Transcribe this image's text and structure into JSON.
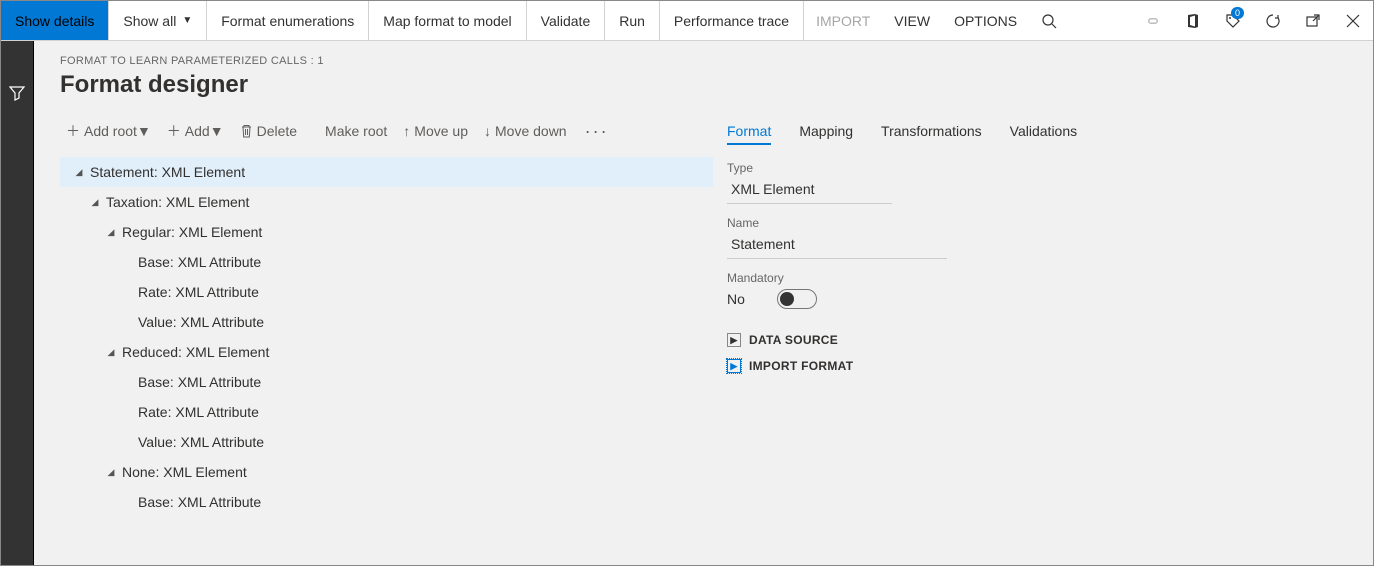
{
  "topbar": {
    "show_details": "Show details",
    "show_all": "Show all",
    "format_enum": "Format enumerations",
    "map_format": "Map format to model",
    "validate": "Validate",
    "run": "Run",
    "perf_trace": "Performance trace",
    "import": "IMPORT",
    "view": "VIEW",
    "options": "OPTIONS",
    "badge": "0"
  },
  "crumb": "FORMAT TO LEARN PARAMETERIZED CALLS : 1",
  "title": "Format designer",
  "toolbar": {
    "add_root": "Add root",
    "add": "Add",
    "delete": "Delete",
    "make_root": "Make root",
    "move_up": "Move up",
    "move_down": "Move down"
  },
  "tree": [
    {
      "indent": 0,
      "expander": "▾",
      "label": "Statement: XML Element",
      "selected": true
    },
    {
      "indent": 1,
      "expander": "▾",
      "label": "Taxation: XML Element"
    },
    {
      "indent": 2,
      "expander": "▾",
      "label": "Regular: XML Element"
    },
    {
      "indent": 3,
      "expander": "",
      "label": "Base: XML Attribute"
    },
    {
      "indent": 3,
      "expander": "",
      "label": "Rate: XML Attribute"
    },
    {
      "indent": 3,
      "expander": "",
      "label": "Value: XML Attribute"
    },
    {
      "indent": 2,
      "expander": "▾",
      "label": "Reduced: XML Element"
    },
    {
      "indent": 3,
      "expander": "",
      "label": "Base: XML Attribute"
    },
    {
      "indent": 3,
      "expander": "",
      "label": "Rate: XML Attribute"
    },
    {
      "indent": 3,
      "expander": "",
      "label": "Value: XML Attribute"
    },
    {
      "indent": 2,
      "expander": "▾",
      "label": "None: XML Element"
    },
    {
      "indent": 3,
      "expander": "",
      "label": "Base: XML Attribute"
    }
  ],
  "tabs": {
    "format": "Format",
    "mapping": "Mapping",
    "transformations": "Transformations",
    "validations": "Validations"
  },
  "panel": {
    "type_lbl": "Type",
    "type_val": "XML Element",
    "name_lbl": "Name",
    "name_val": "Statement",
    "mandatory_lbl": "Mandatory",
    "mandatory_val": "No",
    "data_source": "DATA SOURCE",
    "import_format": "IMPORT FORMAT"
  }
}
